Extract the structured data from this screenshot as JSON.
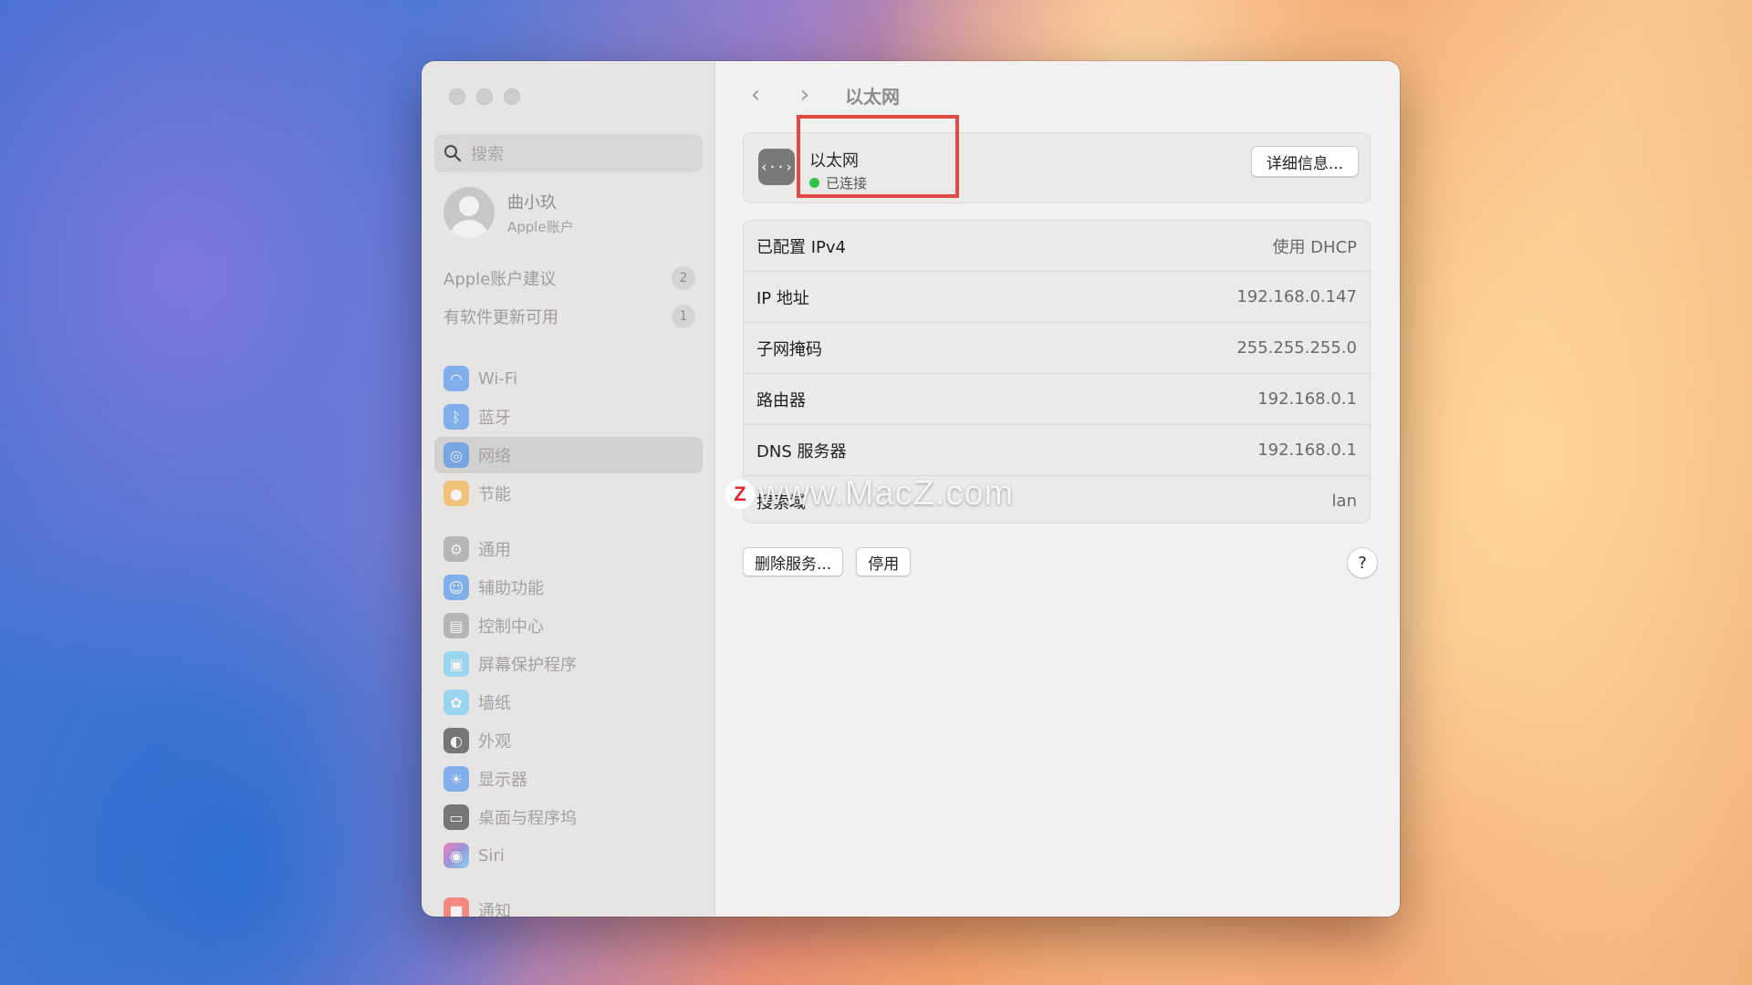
{
  "sidebar": {
    "search_placeholder": "搜索",
    "account": {
      "name": "曲小玖",
      "sub": "Apple账户"
    },
    "suggestions": [
      {
        "label": "Apple账户建议",
        "badge": "2"
      },
      {
        "label": "有软件更新可用",
        "badge": "1"
      }
    ],
    "items": [
      {
        "label": "Wi-Fi",
        "icon": "wifi-icon",
        "color": "#2f84f5"
      },
      {
        "label": "蓝牙",
        "icon": "bluetooth-icon",
        "color": "#2f84f5"
      },
      {
        "label": "网络",
        "icon": "globe-icon",
        "color": "#2f84f5",
        "selected": true
      },
      {
        "label": "节能",
        "icon": "lightbulb-icon",
        "color": "#f5a623"
      },
      {
        "label": "通用",
        "icon": "gear-icon",
        "color": "#8e8e93"
      },
      {
        "label": "辅助功能",
        "icon": "accessibility-icon",
        "color": "#2f84f5"
      },
      {
        "label": "控制中心",
        "icon": "control-center-icon",
        "color": "#8e8e93"
      },
      {
        "label": "屏幕保护程序",
        "icon": "screensaver-icon",
        "color": "#5ac8fa"
      },
      {
        "label": "墙纸",
        "icon": "wallpaper-icon",
        "color": "#5ac8fa"
      },
      {
        "label": "外观",
        "icon": "appearance-icon",
        "color": "#1c1c1e"
      },
      {
        "label": "显示器",
        "icon": "display-icon",
        "color": "#2f84f5"
      },
      {
        "label": "桌面与程序坞",
        "icon": "dock-icon",
        "color": "#1c1c1e"
      },
      {
        "label": "Siri",
        "icon": "siri-icon",
        "color": "#af52de"
      },
      {
        "label": "通知",
        "icon": "notifications-icon",
        "color": "#ff3b30"
      }
    ]
  },
  "content": {
    "title": "以太网",
    "interface": {
      "name": "以太网",
      "status": "已连接",
      "details_button": "详细信息..."
    },
    "rows": [
      {
        "key": "已配置 IPv4",
        "value": "使用 DHCP"
      },
      {
        "key": "IP 地址",
        "value": "192.168.0.147"
      },
      {
        "key": "子网掩码",
        "value": "255.255.255.0"
      },
      {
        "key": "路由器",
        "value": "192.168.0.1"
      },
      {
        "key": "DNS 服务器",
        "value": "192.168.0.1"
      },
      {
        "key": "搜索域",
        "value": "lan"
      }
    ],
    "remove_button": "删除服务...",
    "disable_button": "停用",
    "help": "?"
  },
  "watermark": {
    "logo": "Z",
    "text": "www.MacZ.com"
  },
  "colors": {
    "highlight": "#e34a45",
    "connected": "#2ec44a"
  }
}
